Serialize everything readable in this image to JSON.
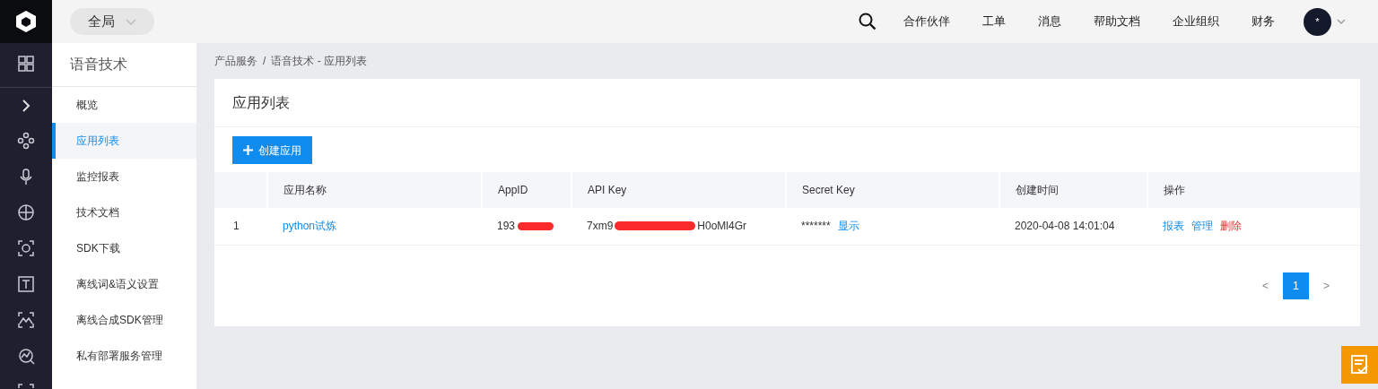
{
  "top_bar": {
    "scope": "全局",
    "nav": [
      "合作伙伴",
      "工单",
      "消息",
      "帮助文档",
      "企业组织",
      "财务"
    ],
    "avatar": "*"
  },
  "sidebar": {
    "title": "语音技术",
    "items": [
      {
        "label": "概览",
        "selected": false
      },
      {
        "label": "应用列表",
        "selected": true
      },
      {
        "label": "监控报表",
        "selected": false
      },
      {
        "label": "技术文档",
        "selected": false
      },
      {
        "label": "SDK下载",
        "selected": false
      },
      {
        "label": "离线词&语义设置",
        "selected": false
      },
      {
        "label": "离线合成SDK管理",
        "selected": false
      },
      {
        "label": "私有部署服务管理",
        "selected": false
      }
    ]
  },
  "breadcrumb": [
    "产品服务",
    "/",
    "语音技术 - 应用列表"
  ],
  "panel": {
    "title": "应用列表",
    "create_button": "创建应用",
    "table": {
      "columns": [
        "",
        "应用名称",
        "AppID",
        "API Key",
        "Secret Key",
        "创建时间",
        "操作"
      ],
      "rows": [
        {
          "index": "1",
          "name": "python试炼",
          "app_id": "193",
          "api_key_start": "7xm9",
          "api_key_end": "H0oMl4Gr",
          "secret_key": "*******",
          "show_link": "显示",
          "created": "2020-04-08 14:01:04",
          "actions": [
            {
              "label": "报表",
              "kind": "link"
            },
            {
              "label": "管理",
              "kind": "link"
            },
            {
              "label": "删除",
              "kind": "danger"
            }
          ]
        }
      ]
    },
    "pagination": {
      "prev": "<",
      "pages": [
        {
          "label": "1",
          "selected": true
        }
      ],
      "next": ">"
    }
  }
}
